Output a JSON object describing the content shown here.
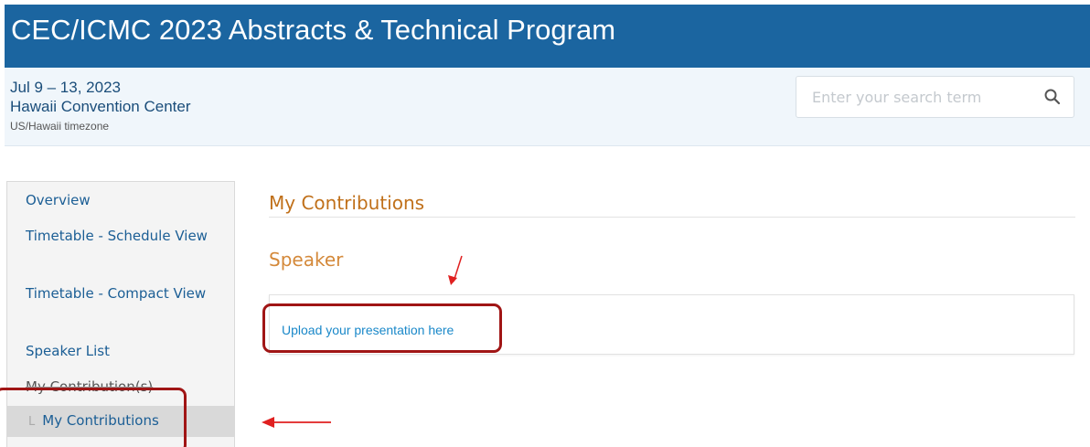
{
  "header": {
    "title": "CEC/ICMC 2023 Abstracts & Technical Program",
    "dates": "Jul 9 – 13, 2023",
    "venue": "Hawaii Convention Center",
    "timezone": "US/Hawaii timezone",
    "brand_color": "#1b65a0"
  },
  "search": {
    "placeholder": "Enter your search term",
    "value": "",
    "icon": "search-icon"
  },
  "sidebar": {
    "items": [
      {
        "label": "Overview"
      },
      {
        "label": "Timetable - Schedule View"
      },
      {
        "label": "Timetable - Compact View"
      },
      {
        "label": "Speaker List"
      },
      {
        "label": "My Contribution(s)"
      }
    ],
    "active_item": {
      "glyph": "L",
      "label": "My Contributions"
    }
  },
  "main": {
    "title": "My Contributions",
    "section": "Speaker",
    "link_text": "Upload your presentation here",
    "accent_color": "#c0701a"
  },
  "annotations": {
    "color": "#a01515"
  }
}
